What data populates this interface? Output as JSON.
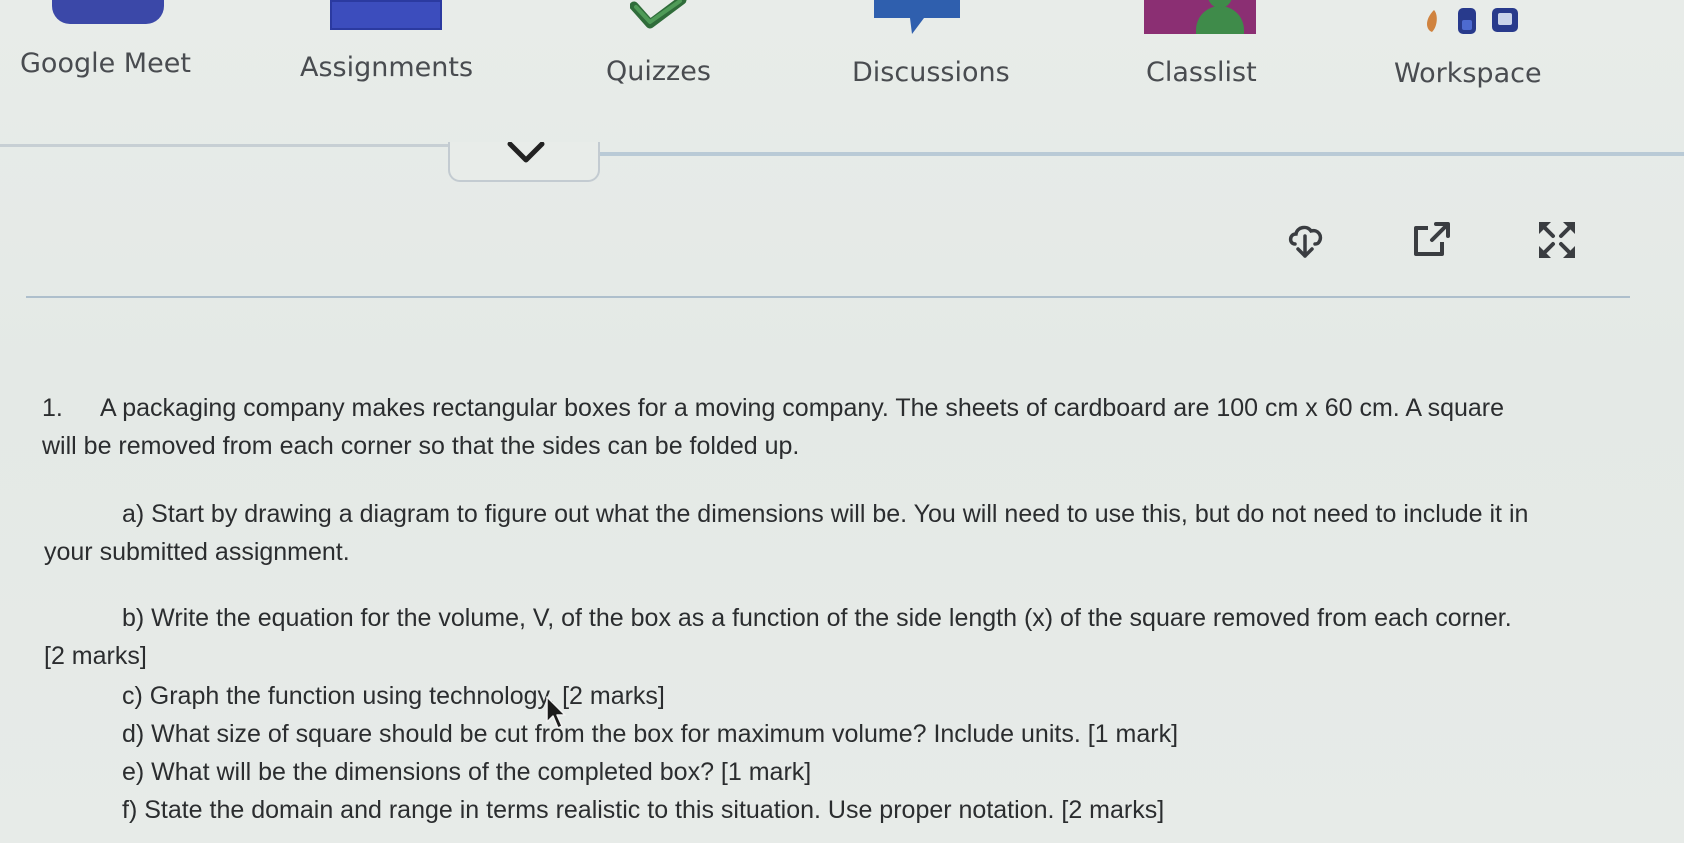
{
  "nav": {
    "items": [
      {
        "label": "Google Meet",
        "icon": "google-meet-icon"
      },
      {
        "label": "Assignments",
        "icon": "assignments-icon"
      },
      {
        "label": "Quizzes",
        "icon": "quizzes-check-icon"
      },
      {
        "label": "Discussions",
        "icon": "discussions-speech-icon"
      },
      {
        "label": "Classlist",
        "icon": "classlist-person-icon"
      },
      {
        "label": "Workspace",
        "icon": "workspace-apps-icon"
      }
    ]
  },
  "toolbar": {
    "icons": [
      "cloud-download-icon",
      "open-external-icon",
      "fullscreen-icon"
    ]
  },
  "question": {
    "number": "1.",
    "intro_line1": "A packaging company makes rectangular boxes for a moving company. The sheets of cardboard are 100 cm x 60 cm. A square",
    "intro_line2": "will be removed from each corner so that the sides can be folded up.",
    "parts": [
      {
        "line1": "a) Start by drawing a diagram to figure out what the dimensions will be. You will need to use this, but do not need to include it in",
        "line2": "your submitted assignment."
      },
      {
        "line1": "b) Write the equation for the volume, V, of the box as a function of the side length (x) of the square removed from each corner.",
        "line2": "[2 marks]"
      },
      {
        "line1": "c) Graph the function using technology. [2 marks]"
      },
      {
        "line1": "d) What size of square should be cut from the box for maximum volume? Include units. [1 mark]"
      },
      {
        "line1": "e) What will be the dimensions of the completed box? [1 mark]"
      },
      {
        "line1": "f) State the domain and range in terms realistic to this situation. Use proper notation. [2 marks]"
      }
    ]
  },
  "colors": {
    "background": "#e6ebe8",
    "meet_tile": "#3b48a8",
    "assignments_tile": "#3c4dbd",
    "quizzes_check": "#3f8b4a",
    "discussions_tile": "#2f5fae",
    "classlist_tile": "#8b2f73",
    "text": "#2b2d2f"
  }
}
